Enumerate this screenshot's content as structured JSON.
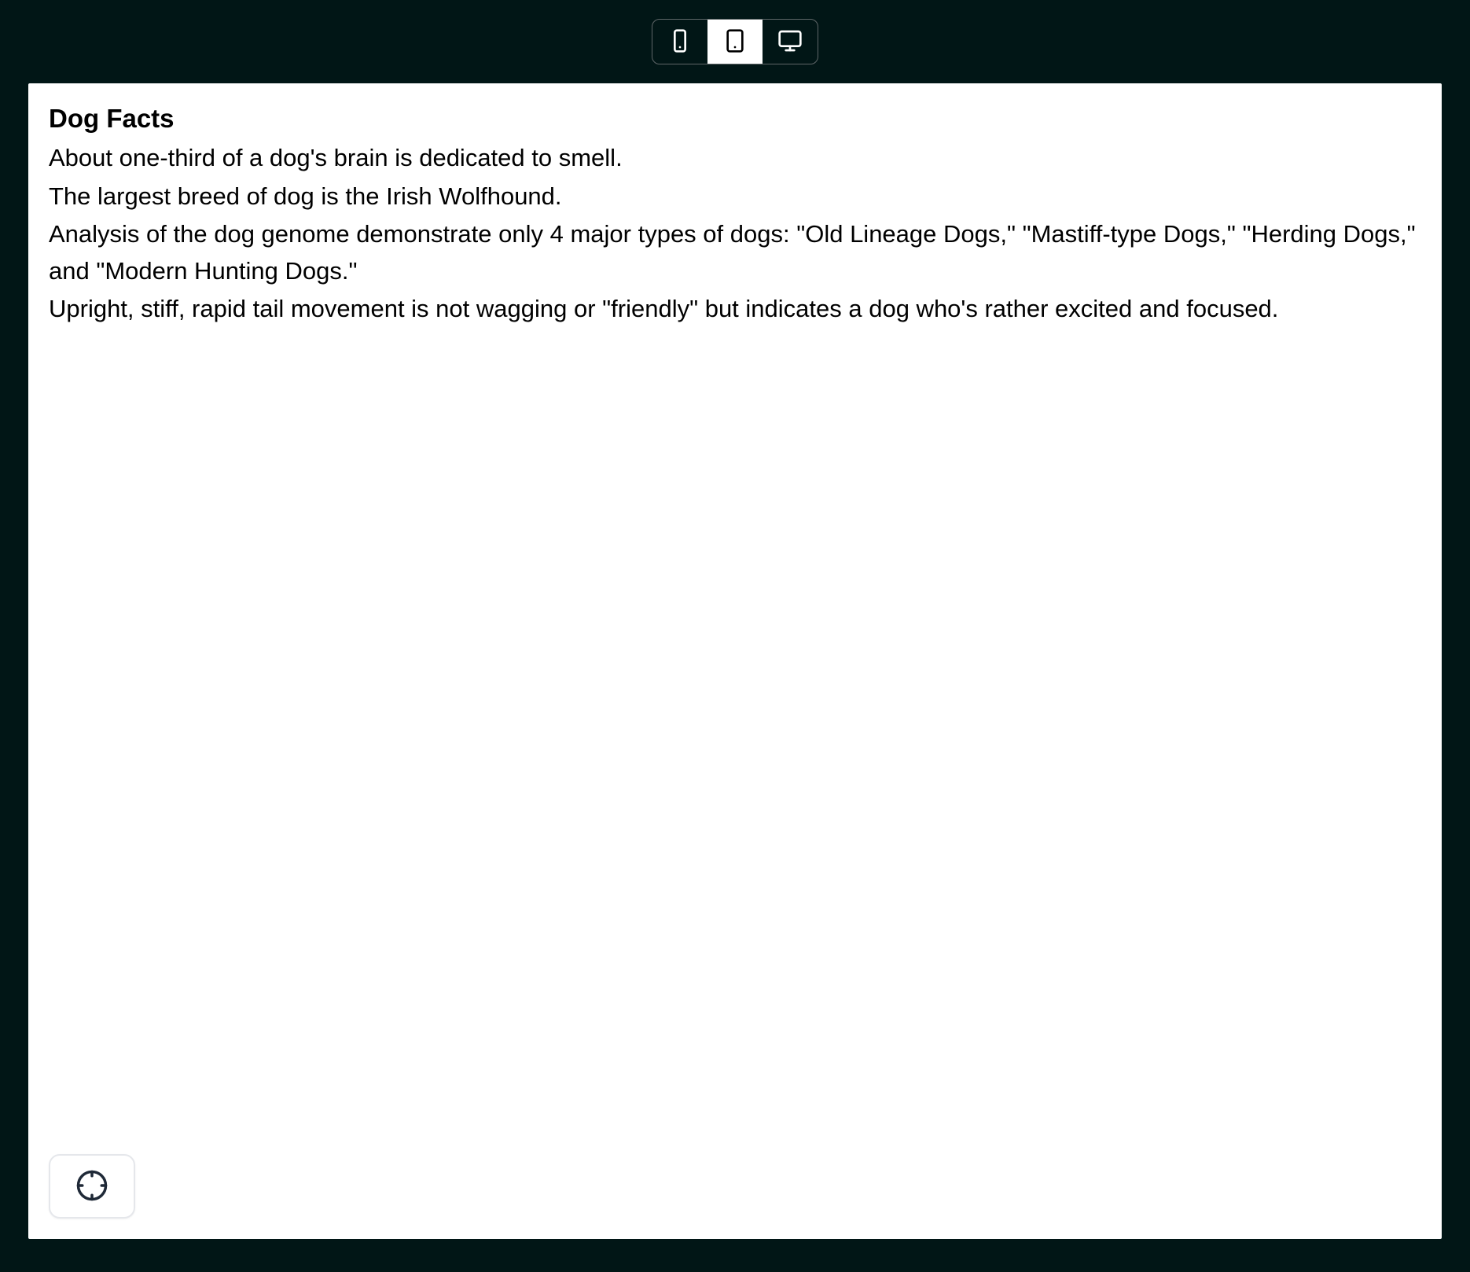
{
  "toolbar": {
    "items": [
      {
        "name": "mobile",
        "active": false
      },
      {
        "name": "tablet",
        "active": true
      },
      {
        "name": "desktop",
        "active": false
      }
    ]
  },
  "content": {
    "heading": "Dog Facts",
    "facts": [
      "About one-third of a dog's brain is dedicated to smell.",
      "The largest breed of dog is the Irish Wolfhound.",
      "Analysis of the dog genome demonstrate only 4 major types of dogs: \"Old Lineage Dogs,\" \"Mastiff-type Dogs,\" \"Herding Dogs,\" and \"Modern Hunting Dogs.\"",
      "Upright, stiff, rapid tail movement is not wagging or \"friendly\" but indicates a dog who's rather excited and focused."
    ]
  },
  "floating_button": {
    "name": "locate"
  }
}
